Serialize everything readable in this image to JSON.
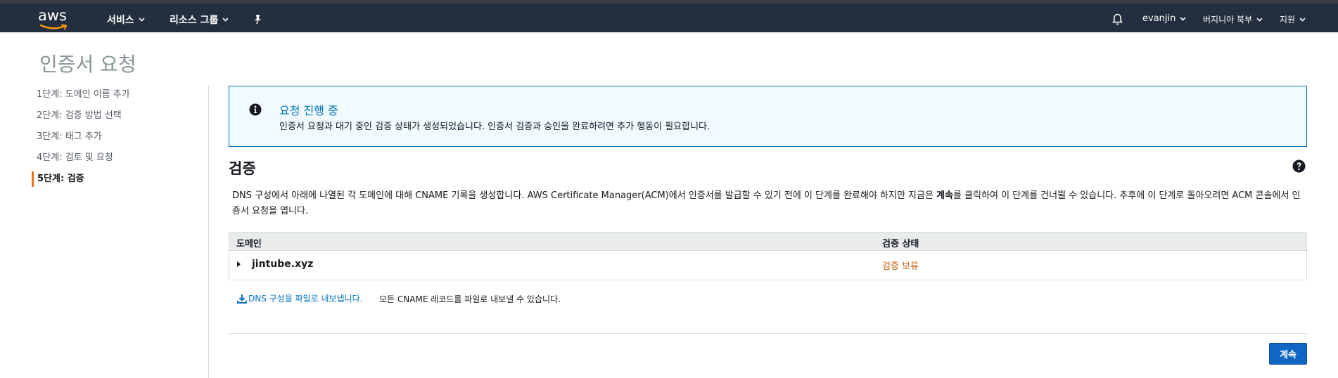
{
  "header": {
    "logo_text": "aws",
    "services": "서비스",
    "resource_groups": "리소스 그룹",
    "user": "evanjin",
    "region": "버지니아 북부",
    "support": "지원"
  },
  "page": {
    "title": "인증서 요청"
  },
  "sidebar": {
    "steps": [
      {
        "label": "1단계: 도메인 이름 추가"
      },
      {
        "label": "2단계: 검증 방법 선택"
      },
      {
        "label": "3단계: 태그 추가"
      },
      {
        "label": "4단계: 검토 및 요청"
      },
      {
        "label": "5단계: 검증"
      }
    ]
  },
  "alert": {
    "title": "요청 진행 중",
    "body": "인증서 요청과 대기 중인 검증 상태가 생성되었습니다. 인증서 검증과 승인을 완료하려면 추가 행동이 필요합니다."
  },
  "section": {
    "title": "검증",
    "desc_before": "DNS 구성에서 아래에 나열된 각 도메인에 대해 CNAME 기록을 생성합니다. AWS Certificate Manager(ACM)에서 인증서를 발급할 수 있기 전에 이 단계를 완료해야 하지만 지금은 ",
    "desc_bold": "계속",
    "desc_after": "를 클릭하여 이 단계를 건너뛸 수 있습니다. 추후에 이 단계로 돌아오려면 ACM 콘솔에서 인증서 요청을 엽니다."
  },
  "table": {
    "headers": {
      "domain": "도메인",
      "status": "검증 상태"
    },
    "rows": [
      {
        "domain": "jintube.xyz",
        "status": "검증 보류"
      }
    ]
  },
  "export": {
    "link": "DNS 구성을 파일로 내보냅니다.",
    "note": "모든 CNAME 레코드를 파일로 내보낼 수 있습니다."
  },
  "actions": {
    "continue": "계속"
  },
  "colors": {
    "nav_bg": "#232f3e",
    "accent_orange": "#ec7211",
    "link_blue": "#0073bb",
    "pending_orange": "#d45b07",
    "primary_button": "#1066c4"
  }
}
